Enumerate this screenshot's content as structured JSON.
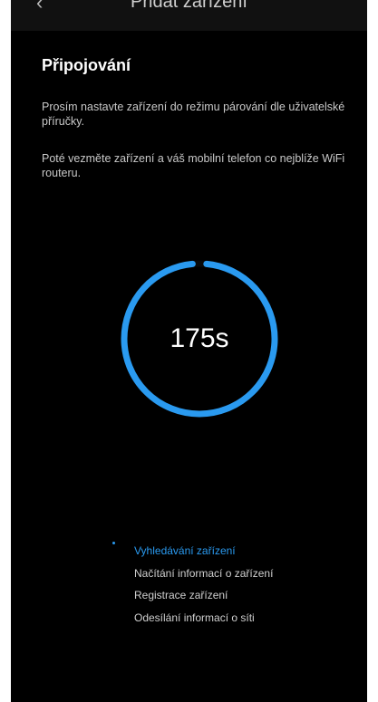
{
  "header": {
    "title": "Přidat zařízení",
    "back_icon": "back-arrow-icon"
  },
  "content": {
    "section_title": "Připojování",
    "instruction_1": "Prosím nastavte zařízení do režimu párování dle uživatelské příručky.",
    "instruction_2": "Poté vezměte zařízení a váš mobilní telefon co nejblíže WiFi routeru."
  },
  "timer": {
    "label": "175s",
    "remaining_fraction": 0.97,
    "color": "#2a9af0"
  },
  "steps": [
    {
      "label": "Vyhledávání zařízení",
      "active": true
    },
    {
      "label": "Načítání informací o zařízení",
      "active": false
    },
    {
      "label": "Registrace zařízení",
      "active": false
    },
    {
      "label": "Odesílání informací o síti",
      "active": false
    }
  ],
  "colors": {
    "background": "#000000",
    "accent": "#2a9af0"
  }
}
